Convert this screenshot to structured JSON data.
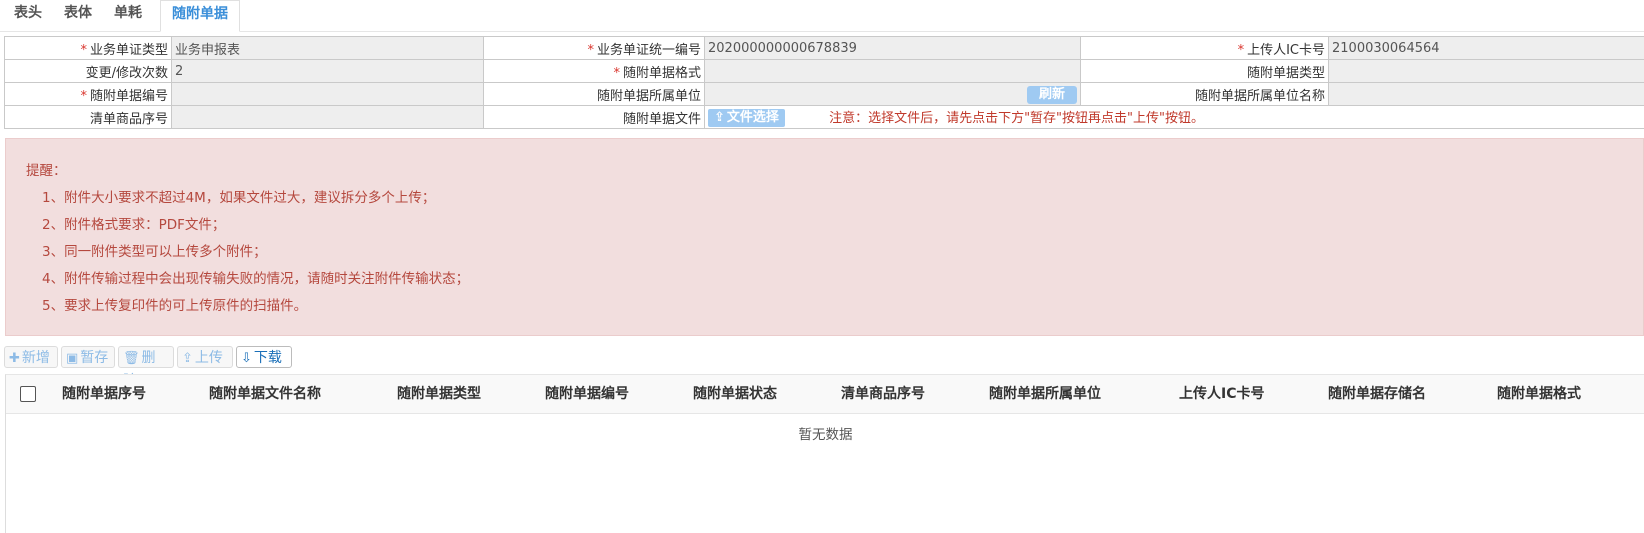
{
  "tabs": [
    {
      "label": "表头"
    },
    {
      "label": "表体"
    },
    {
      "label": "单耗"
    },
    {
      "label": "随附单据"
    }
  ],
  "form": {
    "biz_doc_type_label": "业务单证类型",
    "biz_doc_type_value": "业务申报表",
    "biz_doc_no_label": "业务单证统一编号",
    "biz_doc_no_value": "202000000000678839",
    "uploader_ic_label": "上传人IC卡号",
    "uploader_ic_value": "2100030064564",
    "change_count_label": "变更/修改次数",
    "change_count_value": "2",
    "att_format_label": "随附单据格式",
    "att_format_value": "",
    "att_type_label": "随附单据类型",
    "att_type_value": "",
    "att_no_label": "随附单据编号",
    "att_no_value": "",
    "att_unit_label": "随附单据所属单位",
    "att_unit_value": "",
    "refresh_label": "刷新",
    "att_unit_name_label": "随附单据所属单位名称",
    "att_unit_name_value": "",
    "goods_seq_label": "清单商品序号",
    "goods_seq_value": "",
    "att_file_label": "随附单据文件",
    "file_select_label": "文件选择",
    "notice": "注意：选择文件后，请先点击下方\"暂存\"按钮再点击\"上传\"按钮。"
  },
  "reminder": {
    "title": "提醒：",
    "items": [
      "1、附件大小要求不超过4M，如果文件过大，建议拆分多个上传；",
      "2、附件格式要求：PDF文件；",
      "3、同一附件类型可以上传多个附件；",
      "4、附件传输过程中会出现传输失败的情况，请随时关注附件传输状态；",
      "5、要求上传复印件的可上传原件的扫描件。"
    ]
  },
  "toolbar": {
    "add": "新增",
    "save": "暂存",
    "delete": "删除",
    "upload": "上传",
    "download": "下载"
  },
  "grid": {
    "columns": [
      "随附单据序号",
      "随附单据文件名称",
      "随附单据类型",
      "随附单据编号",
      "随附单据状态",
      "清单商品序号",
      "随附单据所属单位",
      "上传人IC卡号",
      "随附单据存储名",
      "随附单据格式"
    ],
    "empty_text": "暂无数据"
  },
  "colors": {
    "accent": "#3b8fd9",
    "required": "#d9342c",
    "reminder_bg": "#f2dede",
    "reminder_text": "#b5483e"
  }
}
